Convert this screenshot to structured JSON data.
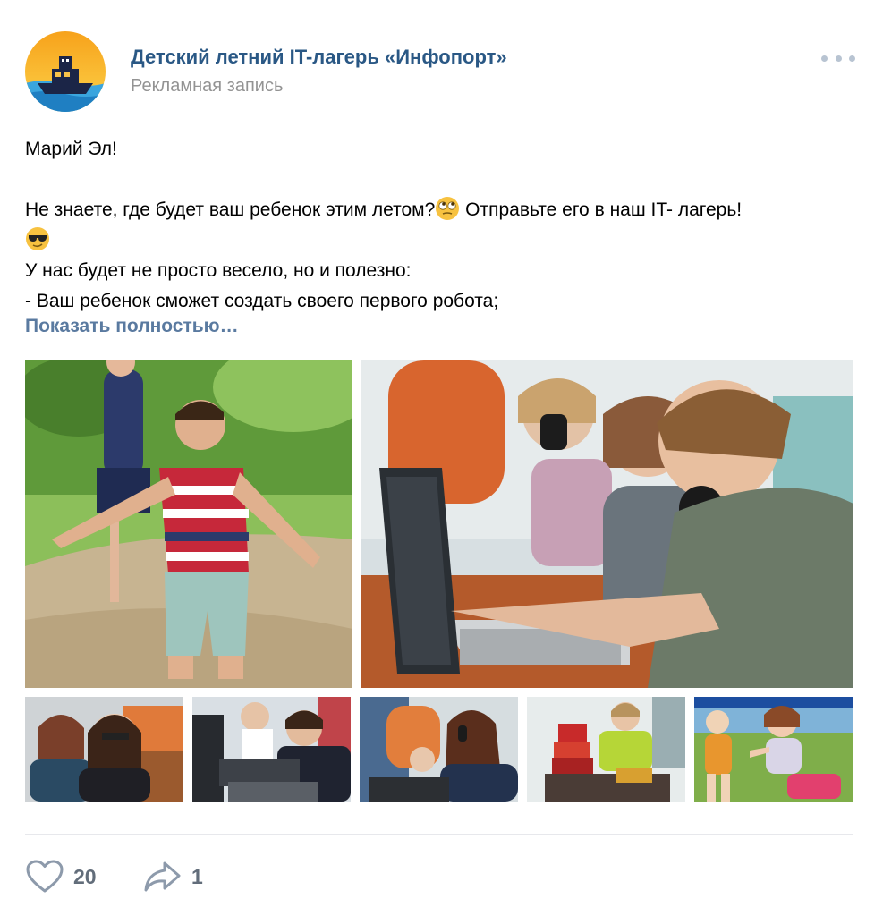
{
  "post": {
    "author_name": "Детский летний IT-лагерь «Инфопорт»",
    "sponsored_label": "Рекламная запись",
    "text": {
      "line1": "Марий Эл!",
      "line2_a": "Не знаете, где будет ваш ребенок этим летом?",
      "line2_b": " Отправьте его в наш IT- лагерь!",
      "line3": "У нас будет не просто весело, но и полезно:",
      "line4": "- Ваш ребенок сможет создать своего первого робота;"
    },
    "emoji": [
      "rolling-eyes-emoji",
      "sunglasses-emoji"
    ],
    "show_more_label": "Показать полностью…",
    "photos": [
      "photo-boy-dancing-outdoors",
      "photo-kids-at-laptops",
      "photo-girls-at-computer",
      "photo-boys-at-keyboards",
      "photo-girl-with-headset",
      "photo-boy-building-blocks",
      "photo-kids-playing-outdoors"
    ],
    "likes": {
      "count": "20",
      "icon": "heart-icon"
    },
    "shares": {
      "count": "1",
      "icon": "share-arrow-icon"
    }
  },
  "colors": {
    "author_link": "#2a5885",
    "secondary_text": "#939393",
    "show_more": "#5a7aa0",
    "action_icon": "#8d9aab",
    "divider": "#e7e8ec"
  }
}
